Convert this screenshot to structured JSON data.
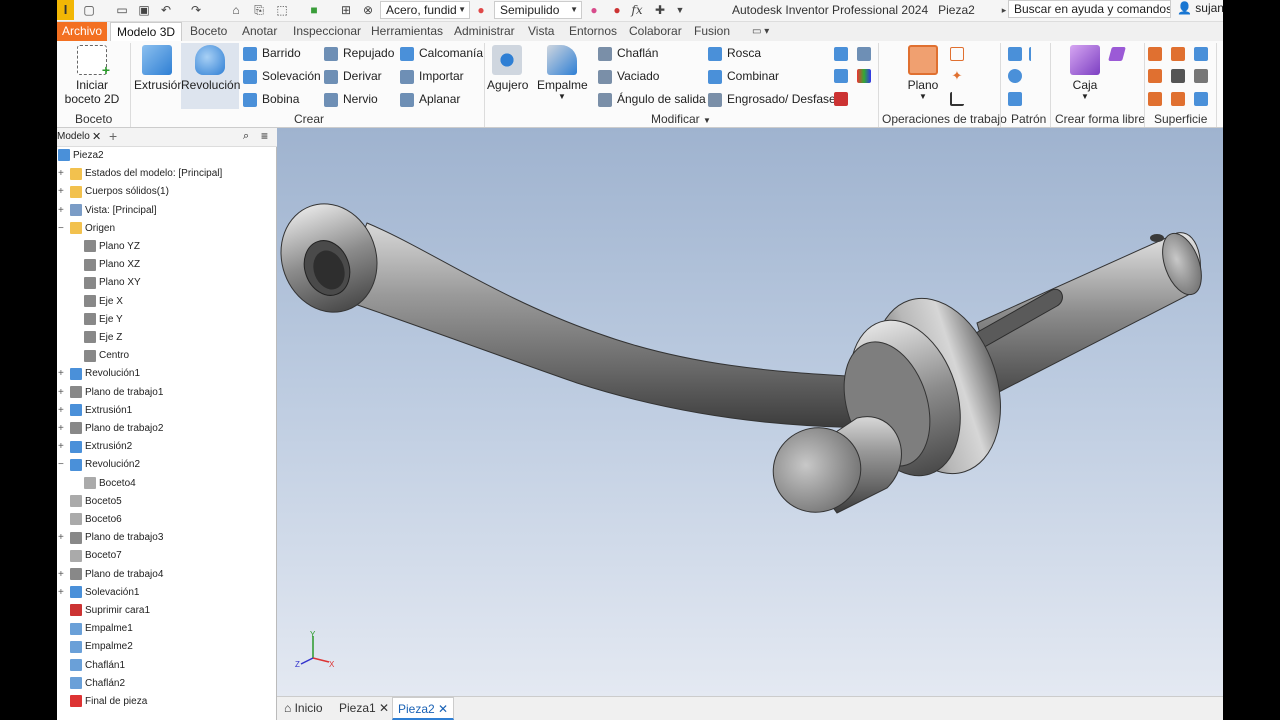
{
  "qat": {
    "logo": "I",
    "material": "Acero, fundid",
    "appearance": "Semipulido",
    "fx": "fx"
  },
  "app_title": "Autodesk Inventor Professional 2024",
  "doc_title": "Pieza2",
  "search_placeholder": "Buscar en ayuda y comandos...",
  "user": "sujann",
  "tabs": [
    "Archivo",
    "Modelo 3D",
    "Boceto",
    "Anotar",
    "Inspeccionar",
    "Herramientas",
    "Administrar",
    "Vista",
    "Entornos",
    "Colaborar",
    "Fusion"
  ],
  "ribbon": {
    "boceto": {
      "label": "Boceto",
      "start_sketch": "Iniciar boceto 2D"
    },
    "crear": {
      "label": "Crear",
      "extrusion": "Extrusión",
      "revolucion": "Revolución",
      "items": [
        "Barrido",
        "Solevación",
        "Bobina",
        "Repujado",
        "Derivar",
        "Nervio",
        "Calcomanía",
        "Importar",
        "Aplanar"
      ]
    },
    "modificar": {
      "label": "Modificar",
      "agujero": "Agujero",
      "empalme": "Empalme",
      "items": [
        "Chaflán",
        "Vaciado",
        "Ángulo de salida",
        "Rosca",
        "Combinar",
        "Engrosado/ Desfase"
      ]
    },
    "operaciones": {
      "label": "Operaciones de trabajo",
      "plano": "Plano"
    },
    "patron": {
      "label": "Patrón"
    },
    "forma_libre": {
      "label": "Crear forma libre",
      "caja": "Caja"
    },
    "superficie": {
      "label": "Superficie"
    }
  },
  "browser": {
    "tab": "Modelo",
    "nodes": [
      {
        "label": "Pieza2",
        "level": 0,
        "icon": "part-icon",
        "color": "#4a90d9"
      },
      {
        "label": "Estados del modelo: [Principal]",
        "level": 1,
        "exp": "+",
        "icon": "folder-icon",
        "color": "#f2c14e"
      },
      {
        "label": "Cuerpos sólidos(1)",
        "level": 1,
        "exp": "+",
        "icon": "folder-icon",
        "color": "#f2c14e"
      },
      {
        "label": "Vista: [Principal]",
        "level": 1,
        "exp": "+",
        "icon": "view-icon",
        "color": "#7a9cc6"
      },
      {
        "label": "Origen",
        "level": 1,
        "exp": "−",
        "icon": "folder-icon",
        "color": "#f2c14e"
      },
      {
        "label": "Plano YZ",
        "level": 2,
        "icon": "plane-icon",
        "color": "#888"
      },
      {
        "label": "Plano XZ",
        "level": 2,
        "icon": "plane-icon",
        "color": "#888"
      },
      {
        "label": "Plano XY",
        "level": 2,
        "icon": "plane-icon",
        "color": "#888"
      },
      {
        "label": "Eje X",
        "level": 2,
        "icon": "axis-icon",
        "color": "#888"
      },
      {
        "label": "Eje Y",
        "level": 2,
        "icon": "axis-icon",
        "color": "#888"
      },
      {
        "label": "Eje Z",
        "level": 2,
        "icon": "axis-icon",
        "color": "#888"
      },
      {
        "label": "Centro",
        "level": 2,
        "icon": "point-icon",
        "color": "#888"
      },
      {
        "label": "Revolución1",
        "level": 1,
        "exp": "+",
        "icon": "revolve-icon",
        "color": "#4a90d9"
      },
      {
        "label": "Plano de trabajo1",
        "level": 1,
        "exp": "+",
        "icon": "plane-icon",
        "color": "#888"
      },
      {
        "label": "Extrusión1",
        "level": 1,
        "exp": "+",
        "icon": "extrude-icon",
        "color": "#4a90d9"
      },
      {
        "label": "Plano de trabajo2",
        "level": 1,
        "exp": "+",
        "icon": "plane-icon",
        "color": "#888"
      },
      {
        "label": "Extrusión2",
        "level": 1,
        "exp": "+",
        "icon": "extrude-icon",
        "color": "#4a90d9"
      },
      {
        "label": "Revolución2",
        "level": 1,
        "exp": "−",
        "icon": "revolve-icon",
        "color": "#4a90d9"
      },
      {
        "label": "Boceto4",
        "level": 2,
        "icon": "sketch-icon",
        "color": "#aaa"
      },
      {
        "label": "Boceto5",
        "level": 1,
        "icon": "sketch-icon",
        "color": "#aaa"
      },
      {
        "label": "Boceto6",
        "level": 1,
        "icon": "sketch-icon",
        "color": "#aaa"
      },
      {
        "label": "Plano de trabajo3",
        "level": 1,
        "exp": "+",
        "icon": "plane-icon",
        "color": "#888"
      },
      {
        "label": "Boceto7",
        "level": 1,
        "icon": "sketch-icon",
        "color": "#aaa"
      },
      {
        "label": "Plano de trabajo4",
        "level": 1,
        "exp": "+",
        "icon": "plane-icon",
        "color": "#888"
      },
      {
        "label": "Solevación1",
        "level": 1,
        "exp": "+",
        "icon": "loft-icon",
        "color": "#4a90d9"
      },
      {
        "label": "Suprimir cara1",
        "level": 1,
        "icon": "delete-face-icon",
        "color": "#c33"
      },
      {
        "label": "Empalme1",
        "level": 1,
        "icon": "fillet-icon",
        "color": "#6aa0d8"
      },
      {
        "label": "Empalme2",
        "level": 1,
        "icon": "fillet-icon",
        "color": "#6aa0d8"
      },
      {
        "label": "Chaflán1",
        "level": 1,
        "icon": "chamfer-icon",
        "color": "#6aa0d8"
      },
      {
        "label": "Chaflán2",
        "level": 1,
        "icon": "chamfer-icon",
        "color": "#6aa0d8"
      },
      {
        "label": "Final de pieza",
        "level": 1,
        "icon": "end-of-part-icon",
        "color": "#d33"
      }
    ]
  },
  "doc_tabs": [
    "Inicio",
    "Pieza1",
    "Pieza2"
  ],
  "triad": {
    "x": "X",
    "y": "Y",
    "z": "Z"
  }
}
